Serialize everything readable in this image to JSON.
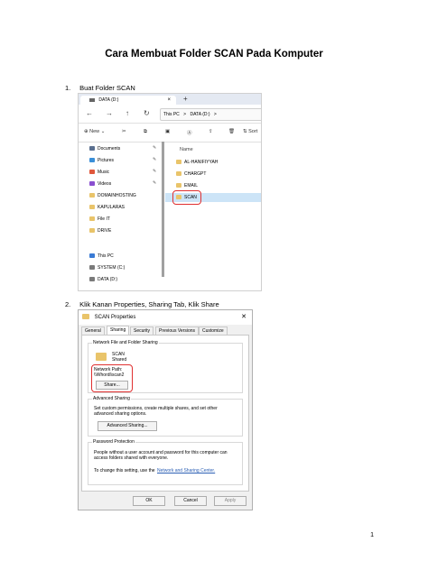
{
  "doc": {
    "title": "Cara Membuat Folder SCAN Pada Komputer",
    "step1": {
      "num": "1.",
      "text": "Buat Folder SCAN"
    },
    "step2": {
      "num": "2.",
      "text": "Klik Kanan Properties, Sharing Tab, Klik Share"
    },
    "page_number": "1"
  },
  "explorer": {
    "tab_label": "DATA (D:)",
    "tab_close": "×",
    "new_tab": "+",
    "nav": {
      "back": "←",
      "forward": "→",
      "up": "↑",
      "refresh": "↻"
    },
    "address": [
      "This PC",
      ">",
      "DATA (D:)",
      ">"
    ],
    "commands": {
      "new": "New",
      "new_chevron": "⌄",
      "sort": "Sort"
    },
    "sidebar": [
      {
        "label": "Documents",
        "color": "#5a6f8f",
        "pinned": true
      },
      {
        "label": "Pictures",
        "color": "#3a8fd8",
        "pinned": true
      },
      {
        "label": "Music",
        "color": "#e0573b",
        "pinned": true
      },
      {
        "label": "Videos",
        "color": "#8a4fd0",
        "pinned": true
      },
      {
        "label": "DOMAINHOSTING",
        "color": "#e9c46a",
        "pinned": false
      },
      {
        "label": "KAPULARAS",
        "color": "#e9c46a",
        "pinned": false
      },
      {
        "label": "File IT",
        "color": "#e9c46a",
        "pinned": false
      },
      {
        "label": "DRIVE",
        "color": "#e9c46a",
        "pinned": false
      },
      {
        "label": "This PC",
        "color": "#3a7bd5",
        "pinned": false
      },
      {
        "label": "SYSTEM (C:)",
        "color": "#7a7a7a",
        "pinned": false
      },
      {
        "label": "DATA (D:)",
        "color": "#7a7a7a",
        "pinned": false
      }
    ],
    "pin_glyph": "✎",
    "column_name": "Name",
    "files": [
      "AL-HANIFIYYAH",
      "CHARGPT",
      "EMAIL",
      "SCAN"
    ]
  },
  "props": {
    "title": "SCAN Properties",
    "close": "✕",
    "tabs": [
      "General",
      "Sharing",
      "Security",
      "Previous Versions",
      "Customize"
    ],
    "nfs_label": "Network File and Folder Sharing",
    "share_name": "SCAN",
    "share_state": "Shared",
    "network_path_label": "Network Path:",
    "network_path": "\\\\Whordi\\scan2",
    "share_button": "Share...",
    "adv_label": "Advanced Sharing",
    "adv_text": "Set custom permissions, create multiple shares, and set other advanced sharing options.",
    "adv_button": "Advanced Sharing...",
    "pwd_label": "Password Protection",
    "pwd_text": "People without a user account and password for this computer can access folders shared with everyone.",
    "pwd_change": "To change this setting, use the",
    "pwd_link": "Network and Sharing Center.",
    "ok": "OK",
    "cancel": "Cancel",
    "apply": "Apply"
  }
}
